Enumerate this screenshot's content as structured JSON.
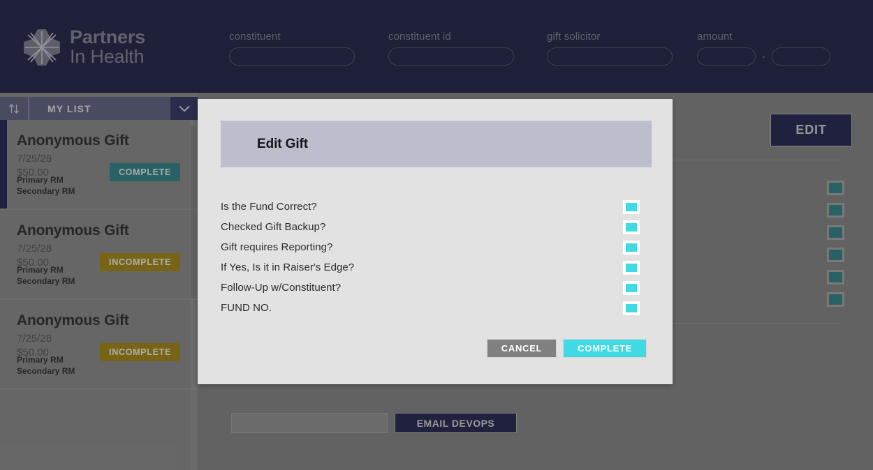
{
  "header": {
    "brand": {
      "line1": "Partners",
      "line2": "In Health",
      "logo_icon": "pinwheel-logo-icon"
    },
    "filters": [
      {
        "label": "constituent",
        "value": "",
        "placeholder": ""
      },
      {
        "label": "constituent id",
        "value": "",
        "placeholder": ""
      },
      {
        "label": "gift solicitor",
        "value": "",
        "placeholder": ""
      }
    ],
    "amount": {
      "label": "amount",
      "min": "",
      "max": "",
      "separator": "-"
    }
  },
  "sidebar": {
    "sort_icon": "sort-updown-icon",
    "list_label": "MY LIST",
    "chevron_icon": "chevron-down-icon",
    "cards": [
      {
        "title": "Anonymous Gift",
        "date": "7/25/28",
        "amount": "$50.00",
        "status": "COMPLETE",
        "status_color": "#2a7b80",
        "primary_rm": "Primary RM",
        "secondary_rm": "Secondary RM",
        "selected": true
      },
      {
        "title": "Anonymous Gift",
        "date": "7/25/28",
        "amount": "$50.00",
        "status": "INCOMPLETE",
        "status_color": "#9b7f10",
        "primary_rm": "Primary RM",
        "secondary_rm": "Secondary RM",
        "selected": false
      },
      {
        "title": "Anonymous Gift",
        "date": "7/25/28",
        "amount": "$50.00",
        "status": "INCOMPLETE",
        "status_color": "#9b7f10",
        "primary_rm": "Primary RM",
        "secondary_rm": "Secondary RM",
        "selected": false
      }
    ]
  },
  "main": {
    "edit_label": "EDIT",
    "checkbox_count": 6,
    "text_input_value": "",
    "email_button_label": "EMAIL DEVOPS"
  },
  "modal": {
    "title": "Edit Gift",
    "questions": [
      {
        "label": "Is the Fund Correct?",
        "checked": true
      },
      {
        "label": "Checked Gift Backup?",
        "checked": true
      },
      {
        "label": "Gift requires Reporting?",
        "checked": true
      },
      {
        "label": "If Yes, Is it in Raiser's Edge?",
        "checked": true
      },
      {
        "label": "Follow-Up w/Constituent?",
        "checked": true
      },
      {
        "label": "FUND NO.",
        "checked": true
      }
    ],
    "cancel_label": "CANCEL",
    "complete_label": "COMPLETE"
  },
  "colors": {
    "brand_navy": "#1d1f4a",
    "accent_cyan": "#40d9e4",
    "status_teal": "#2a7b80",
    "status_gold": "#9b7f10"
  }
}
